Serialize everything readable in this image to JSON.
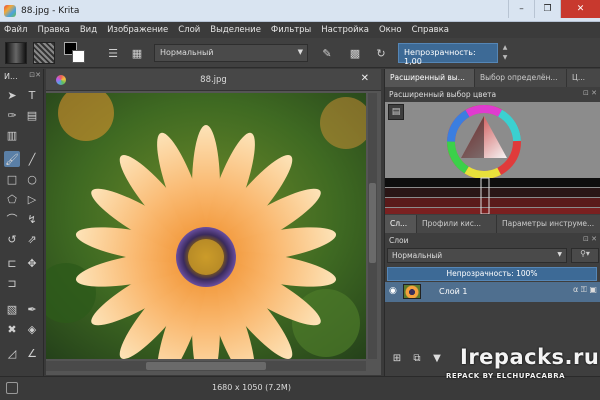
{
  "window": {
    "title": "88.jpg - Krita",
    "controls": [
      "–",
      "❐",
      "✕"
    ]
  },
  "menu": [
    "Файл",
    "Правка",
    "Вид",
    "Изображение",
    "Слой",
    "Выделение",
    "Фильтры",
    "Настройка",
    "Окно",
    "Справка"
  ],
  "toolbar": {
    "blend_mode": "Нормальный",
    "opacity_label": "Непрозрачность: 1,00"
  },
  "toolbox": {
    "title": "И..."
  },
  "document": {
    "tab_title": "88.jpg",
    "status": "1680 x 1050 (7.2M)"
  },
  "docker_tabs": [
    "Расширенный вы...",
    "Выбор определён...",
    "Ц..."
  ],
  "color_selector": {
    "title": "Расширенный выбор цвета"
  },
  "docker_tabs2": [
    "Сл...",
    "Профили кис...",
    "Параметры инструме..."
  ],
  "layers": {
    "title": "Слои",
    "blend_mode": "Нормальный",
    "opacity_label": "Непрозрачность:  100%",
    "items": [
      {
        "name": "Слой 1"
      }
    ]
  },
  "watermark": {
    "line1": "Irepacks.ru",
    "line2": "REPACK BY ELCHUPACABRA"
  }
}
